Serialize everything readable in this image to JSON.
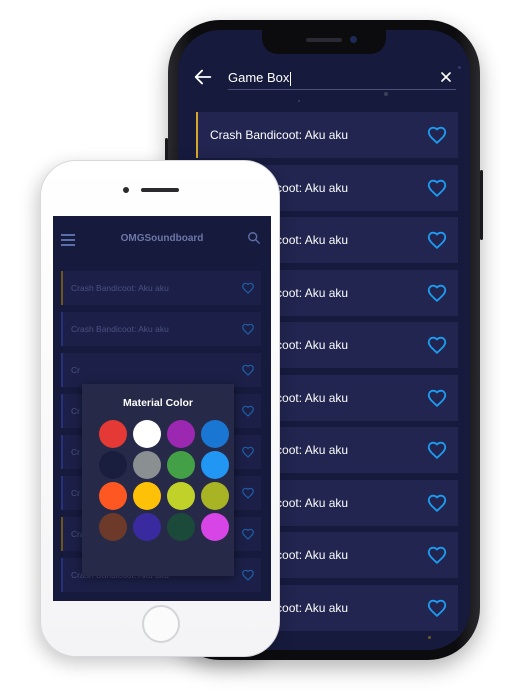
{
  "back_device": {
    "search": {
      "query": "Game Box"
    },
    "items": [
      {
        "title": "Crash Bandicoot: Aku aku",
        "highlighted": true
      },
      {
        "title": "Crash Bandicoot: Aku aku"
      },
      {
        "title": "Crash Bandicoot: Aku aku"
      },
      {
        "title": "Crash Bandicoot: Aku aku"
      },
      {
        "title": "Crash Bandicoot: Aku aku"
      },
      {
        "title": "Crash Bandicoot: Aku aku"
      },
      {
        "title": "Crash Bandicoot: Aku aku"
      },
      {
        "title": "Crash Bandicoot: Aku aku"
      },
      {
        "title": "Crash Bandicoot: Aku aku"
      },
      {
        "title": "Crash Bandicoot: Aku aku"
      }
    ],
    "icons": {
      "back": "arrow-left-icon",
      "clear": "close-icon",
      "favorite": "heart-outline-icon"
    },
    "colors": {
      "background": "#161a3d",
      "item": "#21254f",
      "accent": "#1e9bf0",
      "highlight": "#d6a82a"
    }
  },
  "front_device": {
    "app_title": "OMGSoundboard",
    "icons": {
      "menu": "hamburger-menu-icon",
      "search": "search-icon",
      "favorite": "heart-outline-icon"
    },
    "items": [
      {
        "title": "Crash Bandicoot: Aku aku"
      },
      {
        "title": "Crash Bandicoot: Aku aku"
      },
      {
        "title": "Cr"
      },
      {
        "title": "Cr"
      },
      {
        "title": "Cr"
      },
      {
        "title": "Cr"
      },
      {
        "title": "Crash Bandicoot: Aku aku"
      },
      {
        "title": "Crash Bandicoot: Aku aku"
      }
    ],
    "dialog": {
      "title": "Material Color",
      "colors": [
        "#e53935",
        "#ffffff",
        "#9c27b0",
        "#1976d2",
        "#1a1e3e",
        "#8a8f92",
        "#43a047",
        "#2196f3",
        "#ff5722",
        "#ffc107",
        "#c0d22a",
        "#a9b424",
        "#6d3a2a",
        "#3a2aa0",
        "#1b4a3a",
        "#d745e6"
      ]
    }
  }
}
